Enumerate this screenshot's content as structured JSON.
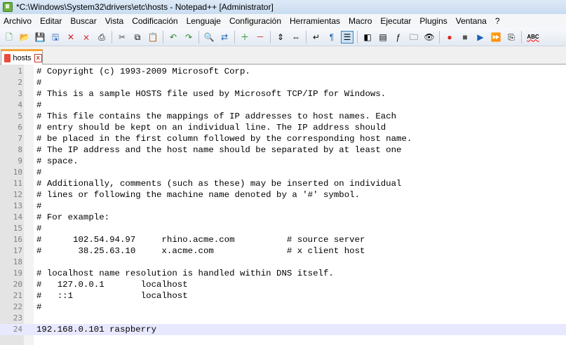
{
  "window": {
    "title": "*C:\\Windows\\System32\\drivers\\etc\\hosts - Notepad++ [Administrator]"
  },
  "menu": [
    "Archivo",
    "Editar",
    "Buscar",
    "Vista",
    "Codificación",
    "Lenguaje",
    "Configuración",
    "Herramientas",
    "Macro",
    "Ejecutar",
    "Plugins",
    "Ventana",
    "?"
  ],
  "toolbar": {
    "icons": [
      "new-file-icon",
      "open-file-icon",
      "save-icon",
      "save-all-icon",
      "close-icon",
      "close-all-icon",
      "print-icon",
      "|",
      "cut-icon",
      "copy-icon",
      "paste-icon",
      "|",
      "undo-icon",
      "redo-icon",
      "|",
      "find-icon",
      "replace-icon",
      "|",
      "zoom-in-icon",
      "zoom-out-icon",
      "|",
      "sync-vertical-icon",
      "sync-horizontal-icon",
      "|",
      "word-wrap-icon",
      "show-all-chars-icon",
      "indent-guide-icon",
      "|",
      "user-defined-language-icon",
      "doc-map-icon",
      "function-list-icon",
      "folder-workspace-icon",
      "monitoring-icon",
      "|",
      "record-macro-icon",
      "stop-record-icon",
      "play-macro-icon",
      "play-multiple-icon",
      "save-macro-icon",
      "|",
      "spellcheck-icon"
    ],
    "spellcheck_label": "ABC"
  },
  "tab": {
    "label": "hosts",
    "close_label": "x"
  },
  "editor": {
    "current_line": 24,
    "lines": [
      {
        "num": "1",
        "text": "# Copyright (c) 1993-2009 Microsoft Corp."
      },
      {
        "num": "2",
        "text": "#"
      },
      {
        "num": "3",
        "text": "# This is a sample HOSTS file used by Microsoft TCP/IP for Windows."
      },
      {
        "num": "4",
        "text": "#"
      },
      {
        "num": "5",
        "text": "# This file contains the mappings of IP addresses to host names. Each"
      },
      {
        "num": "6",
        "text": "# entry should be kept on an individual line. The IP address should"
      },
      {
        "num": "7",
        "text": "# be placed in the first column followed by the corresponding host name."
      },
      {
        "num": "8",
        "text": "# The IP address and the host name should be separated by at least one"
      },
      {
        "num": "9",
        "text": "# space."
      },
      {
        "num": "10",
        "text": "#"
      },
      {
        "num": "11",
        "text": "# Additionally, comments (such as these) may be inserted on individual"
      },
      {
        "num": "12",
        "text": "# lines or following the machine name denoted by a '#' symbol."
      },
      {
        "num": "13",
        "text": "#"
      },
      {
        "num": "14",
        "text": "# For example:"
      },
      {
        "num": "15",
        "text": "#"
      },
      {
        "num": "16",
        "text": "#      102.54.94.97     rhino.acme.com          # source server"
      },
      {
        "num": "17",
        "text": "#       38.25.63.10     x.acme.com              # x client host"
      },
      {
        "num": "18",
        "text": ""
      },
      {
        "num": "19",
        "text": "# localhost name resolution is handled within DNS itself."
      },
      {
        "num": "20",
        "text": "#   127.0.0.1       localhost"
      },
      {
        "num": "21",
        "text": "#   ::1             localhost"
      },
      {
        "num": "22",
        "text": "#"
      },
      {
        "num": "23",
        "text": ""
      },
      {
        "num": "24",
        "text": "192.168.0.101 raspberry"
      }
    ]
  }
}
